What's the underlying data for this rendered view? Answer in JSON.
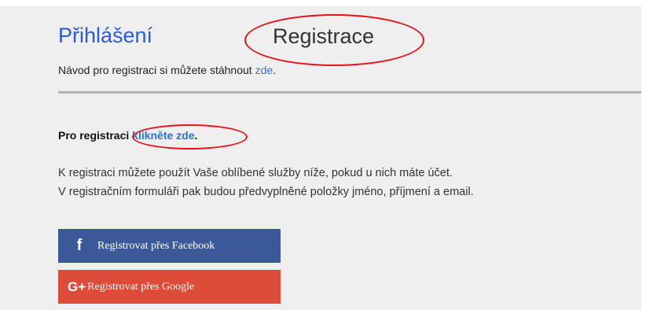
{
  "tabs": {
    "login_label": "Přihlášení",
    "register_label": "Registrace"
  },
  "guide": {
    "text": "Návod pro registraci si můžete stáhnout ",
    "link": "zde",
    "end": "."
  },
  "register": {
    "prefix": "Pro registraci ",
    "link": "klikněte zde",
    "end": "."
  },
  "info": {
    "line1": "K registraci můžete použít Vaše oblíbené služby níže, pokud u nich máte účet.",
    "line2": "V registračním formuláři pak budou předvyplněné položky jméno, příjmení a email."
  },
  "buttons": {
    "facebook": {
      "label": "Registrovat přes Facebook",
      "icon": "facebook-icon",
      "glyph": "f",
      "color": "#3b5998"
    },
    "google": {
      "label": "Registrovat přes Google",
      "icon": "google-plus-icon",
      "glyph": "G+",
      "color": "#dd4b39"
    }
  },
  "annotation_color": "#e8121a"
}
